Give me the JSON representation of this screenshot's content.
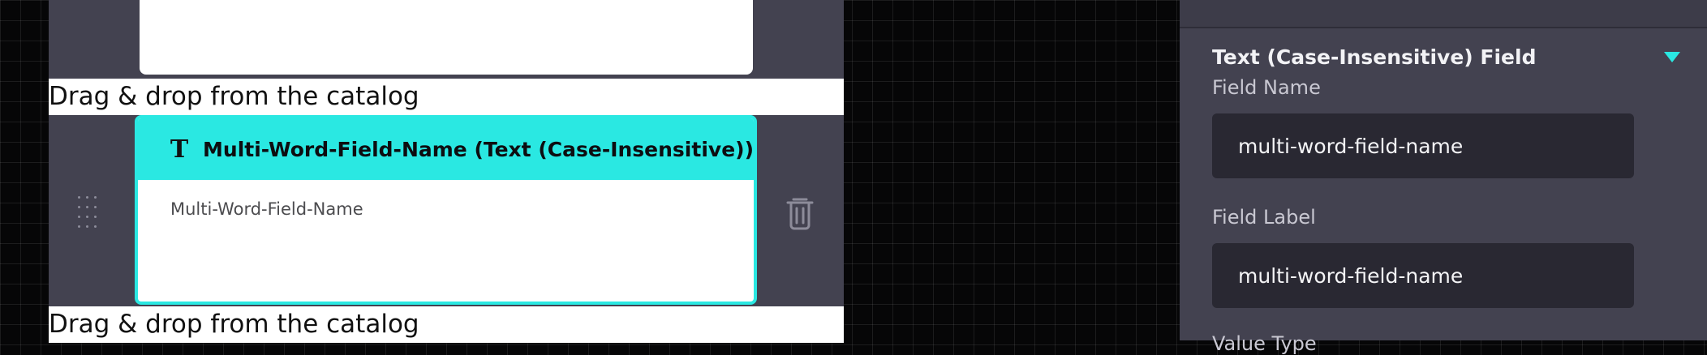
{
  "canvas": {
    "drop_hint_text": "Drag & drop from the catalog",
    "drop_hint_text_2": "Drag & drop from the catalog",
    "field_card": {
      "type_icon": "text-type-icon",
      "title": "Multi-Word-Field-Name (Text (Case-Insensitive))",
      "preview_label": "Multi-Word-Field-Name",
      "accent_color": "#2ae8e2"
    },
    "drag_handle_icon": "drag-dots-icon",
    "delete_icon": "trash-icon"
  },
  "properties_panel": {
    "section_title": "Text (Case-Insensitive) Field",
    "collapse_icon": "caret-down-icon",
    "field_name_label": "Field Name",
    "field_name_value": "multi-word-field-name",
    "field_label_label": "Field Label",
    "field_label_value": "multi-word-field-name",
    "next_label": "Value Type"
  }
}
